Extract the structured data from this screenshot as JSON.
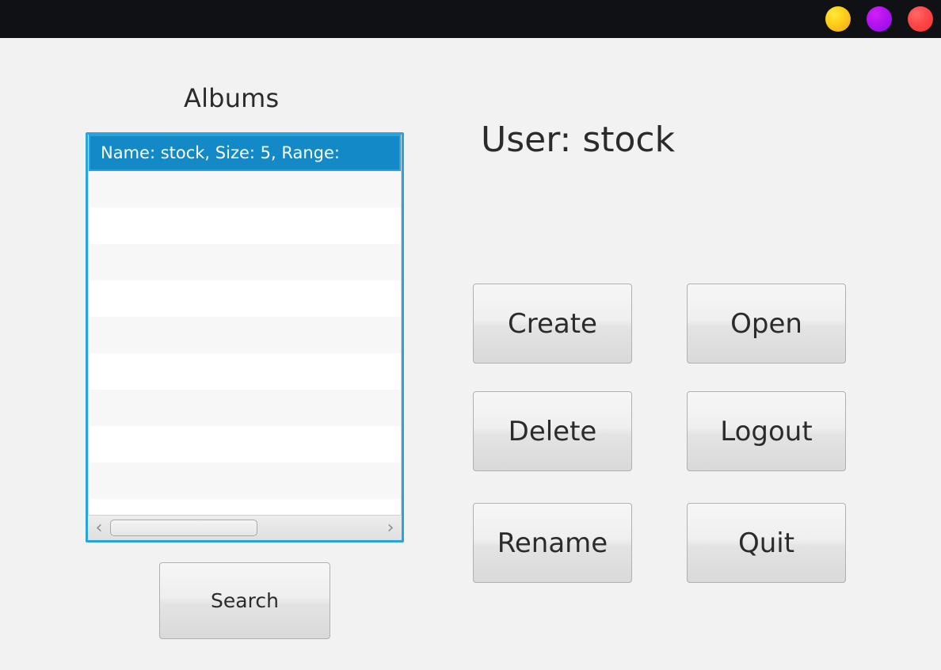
{
  "window": {
    "controls": [
      {
        "name": "minimize",
        "color": "#f9c51b"
      },
      {
        "name": "maximize",
        "color": "#b614f0"
      },
      {
        "name": "close",
        "color": "#f8332c"
      }
    ]
  },
  "left_panel": {
    "label": "Albums",
    "list": {
      "selected_index": 0,
      "rows": [
        {
          "text": "Name: stock, Size: 5, Range:",
          "selected": true
        },
        {
          "text": "",
          "selected": false
        },
        {
          "text": "",
          "selected": false
        },
        {
          "text": "",
          "selected": false
        },
        {
          "text": "",
          "selected": false
        },
        {
          "text": "",
          "selected": false
        },
        {
          "text": "",
          "selected": false
        },
        {
          "text": "",
          "selected": false
        },
        {
          "text": "",
          "selected": false
        },
        {
          "text": "",
          "selected": false
        },
        {
          "text": "",
          "selected": false
        }
      ],
      "scrollbar": {
        "left_arrow": "‹",
        "right_arrow": "›"
      }
    },
    "search_button": "Search"
  },
  "right_panel": {
    "user_heading": "User: stock",
    "buttons": [
      {
        "id": "create",
        "label": "Create"
      },
      {
        "id": "open",
        "label": "Open"
      },
      {
        "id": "delete",
        "label": "Delete"
      },
      {
        "id": "logout",
        "label": "Logout"
      },
      {
        "id": "rename",
        "label": "Rename"
      },
      {
        "id": "quit",
        "label": "Quit"
      }
    ]
  },
  "colors": {
    "accent_blue": "#1389c8",
    "focus_ring": "#29a4dd",
    "titlebar": "#0f1115",
    "background": "#f2f2f2"
  }
}
